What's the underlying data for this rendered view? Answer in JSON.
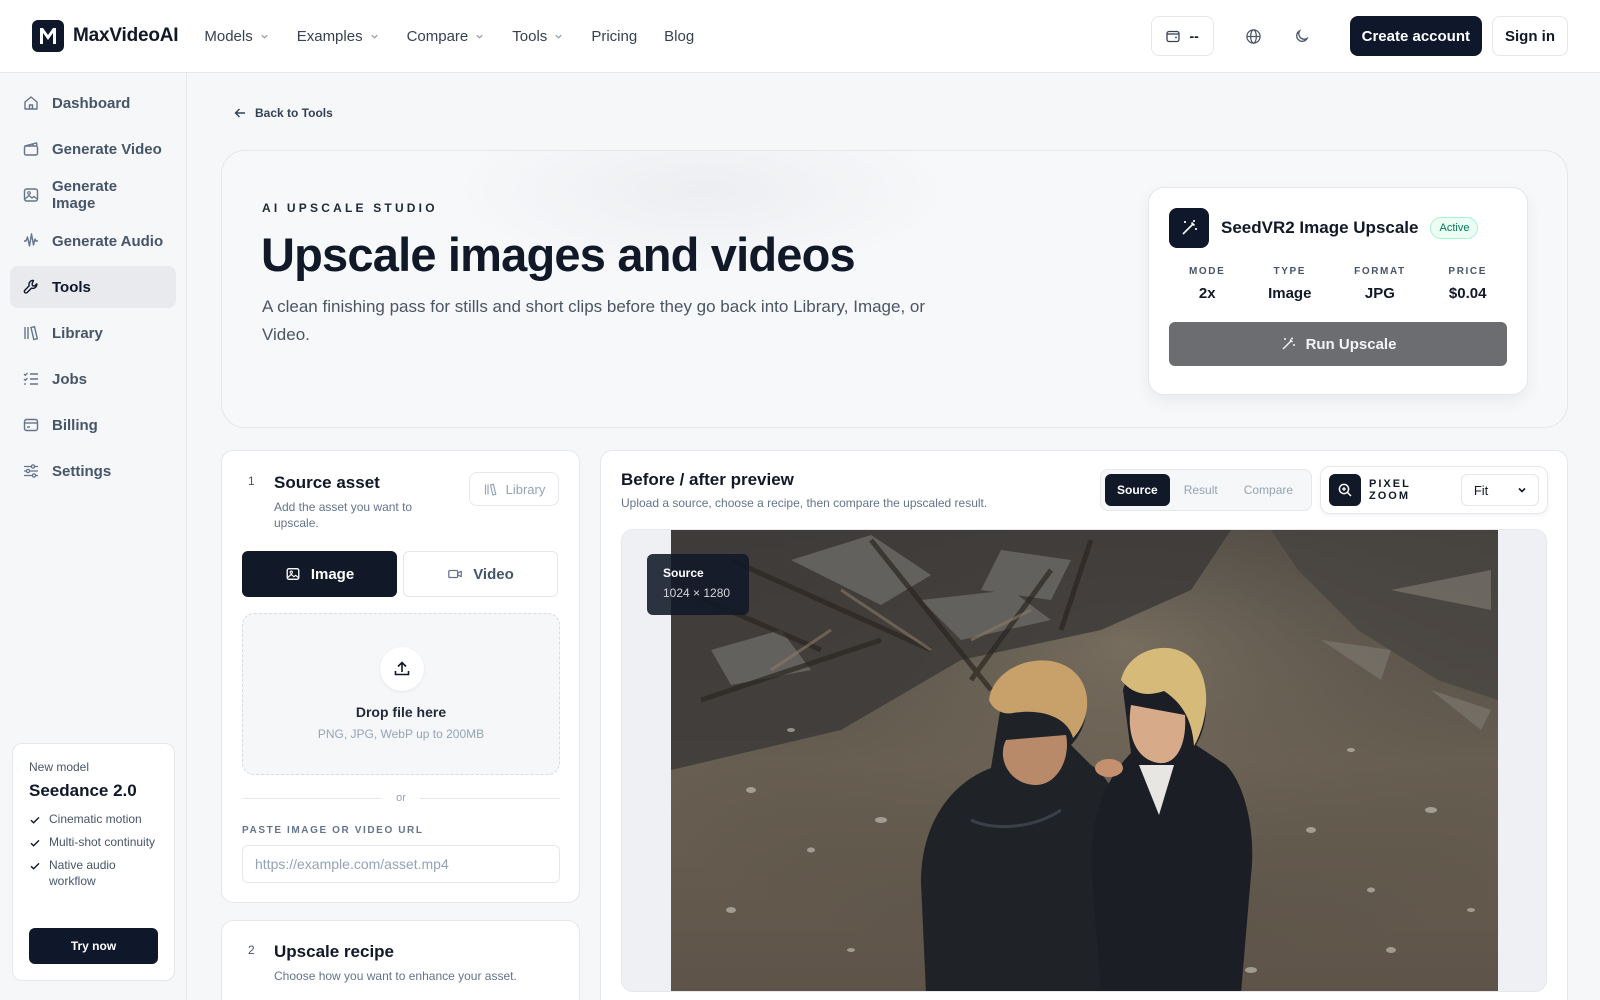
{
  "app": {
    "name": "MaxVideoAI"
  },
  "nav": [
    {
      "label": "Models",
      "dropdown": true
    },
    {
      "label": "Examples",
      "dropdown": true
    },
    {
      "label": "Compare",
      "dropdown": true
    },
    {
      "label": "Tools",
      "dropdown": true
    },
    {
      "label": "Pricing",
      "dropdown": false
    },
    {
      "label": "Blog",
      "dropdown": false
    }
  ],
  "header": {
    "credits": "--",
    "create_account": "Create account",
    "sign_in": "Sign in"
  },
  "sidebar": {
    "items": [
      {
        "label": "Dashboard",
        "icon": "home-icon"
      },
      {
        "label": "Generate Video",
        "icon": "clapper-icon"
      },
      {
        "label": "Generate Image",
        "icon": "image-icon"
      },
      {
        "label": "Generate Audio",
        "icon": "audio-wave-icon"
      },
      {
        "label": "Tools",
        "icon": "wrench-icon",
        "active": true
      },
      {
        "label": "Library",
        "icon": "library-icon"
      },
      {
        "label": "Jobs",
        "icon": "list-check-icon"
      },
      {
        "label": "Billing",
        "icon": "wallet-icon"
      },
      {
        "label": "Settings",
        "icon": "sliders-icon"
      }
    ],
    "promo": {
      "kicker": "New model",
      "title": "Seedance 2.0",
      "features": [
        "Cinematic motion",
        "Multi-shot continuity",
        "Native audio workflow"
      ],
      "cta": "Try now"
    }
  },
  "page": {
    "back": "Back to Tools",
    "kicker": "AI UPSCALE STUDIO",
    "title": "Upscale images and videos",
    "description": "A clean finishing pass for stills and short clips before they go back into Library, Image, or Video."
  },
  "model": {
    "name": "SeedVR2 Image Upscale",
    "status": "Active",
    "stats": [
      {
        "label": "MODE",
        "value": "2x"
      },
      {
        "label": "TYPE",
        "value": "Image"
      },
      {
        "label": "FORMAT",
        "value": "JPG"
      },
      {
        "label": "PRICE",
        "value": "$0.04"
      }
    ],
    "run_label": "Run Upscale"
  },
  "source": {
    "step": "1",
    "title": "Source asset",
    "subtitle": "Add the asset you want to upscale.",
    "library_label": "Library",
    "tabs": [
      "Image",
      "Video"
    ],
    "active_tab": "Image",
    "drop_title": "Drop file here",
    "drop_sub": "PNG, JPG, WebP up to 200MB",
    "or": "or",
    "url_label": "PASTE IMAGE OR VIDEO URL",
    "url_placeholder": "https://example.com/asset.mp4",
    "url_value": ""
  },
  "recipe": {
    "step": "2",
    "title": "Upscale recipe",
    "subtitle": "Choose how you want to enhance your asset."
  },
  "preview": {
    "title": "Before / after preview",
    "subtitle": "Upload a source, choose a recipe, then compare the upscaled result.",
    "tabs": [
      "Source",
      "Result",
      "Compare"
    ],
    "active_tab": "Source",
    "zoom_label": "PIXEL ZOOM",
    "zoom_value": "Fit",
    "source_tag": "Source",
    "source_dims": "1024 × 1280"
  },
  "colors": {
    "primary": "#0f172a",
    "accent_green": "#047857",
    "run_button": "#6b6d70"
  }
}
